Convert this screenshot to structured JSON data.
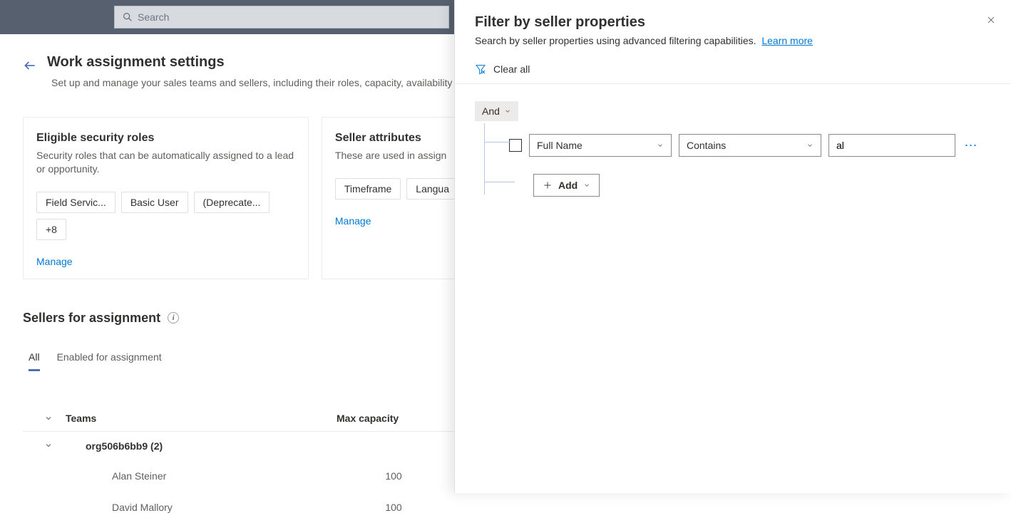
{
  "header": {
    "search_placeholder": "Search"
  },
  "page": {
    "title": "Work assignment settings",
    "subtitle": "Set up and manage your sales teams and sellers, including their roles, capacity, availability a"
  },
  "cards": {
    "roles": {
      "title": "Eligible security roles",
      "subtitle": "Security roles that can be automatically assigned to a lead or opportunity.",
      "chips": [
        "Field Servic...",
        "Basic User",
        "(Deprecate...",
        "+8"
      ],
      "manage": "Manage"
    },
    "attrs": {
      "title": "Seller attributes",
      "subtitle": "These are used in assign",
      "chips": [
        "Timeframe",
        "Langua"
      ],
      "manage": "Manage"
    }
  },
  "sellers": {
    "section_title": "Sellers for assignment",
    "tabs": {
      "all": "All",
      "enabled": "Enabled for assignment",
      "active": "all"
    },
    "columns": {
      "teams": "Teams",
      "capacity": "Max capacity"
    },
    "group": {
      "label": "org506b6bb9 (2)"
    },
    "rows": [
      {
        "name": "Alan Steiner",
        "capacity": "100"
      },
      {
        "name": "David Mallory",
        "capacity": "100"
      }
    ]
  },
  "panel": {
    "title": "Filter by seller properties",
    "subtitle": "Search by seller properties using advanced filtering capabilities.",
    "learn_more": "Learn more",
    "clear_all": "Clear all",
    "logic": "And",
    "condition": {
      "field": "Full Name",
      "operator": "Contains",
      "value": "al"
    },
    "add_label": "Add"
  }
}
